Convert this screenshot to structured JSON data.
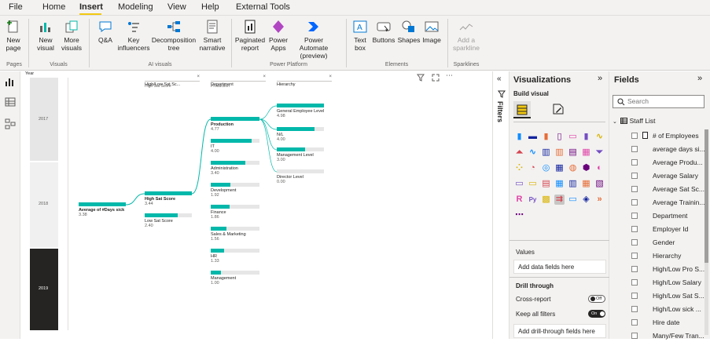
{
  "menu": [
    "File",
    "Home",
    "Insert",
    "Modeling",
    "View",
    "Help",
    "External Tools"
  ],
  "menu_active": "Insert",
  "ribbon": {
    "new_page": "New\npage",
    "new_visual": "New\nvisual",
    "more_visuals": "More\nvisuals",
    "qa": "Q&A",
    "key_influencers": "Key\ninfluencers",
    "decomposition_tree": "Decomposition\ntree",
    "smart_narrative": "Smart\nnarrative",
    "paginated_report": "Paginated\nreport",
    "power_apps": "Power\nApps",
    "power_automate": "Power Automate\n(preview)",
    "text_box": "Text\nbox",
    "buttons": "Buttons",
    "shapes": "Shapes",
    "image": "Image",
    "add_sparkline": "Add a\nsparkline",
    "groups": {
      "pages": "Pages",
      "visuals": "Visuals",
      "ai": "AI visuals",
      "platform": "Power Platform",
      "elements": "Elements",
      "sparklines": "Sparklines"
    }
  },
  "canvas": {
    "year_label": "Year",
    "years": [
      "2017",
      "2018",
      "2019"
    ],
    "headers": [
      {
        "title": "High/Low Sat Sc...",
        "sub": "High Sat Score"
      },
      {
        "title": "Department",
        "sub": "Production"
      },
      {
        "title": "Hierarchy",
        "sub": ""
      }
    ],
    "root": {
      "label": "Average of #Days sick",
      "value": "3.38"
    },
    "level1": [
      {
        "label": "High Sat Score",
        "value": "3.44",
        "bold": true,
        "fill": 1.0
      },
      {
        "label": "Low Sat Score",
        "value": "2.40",
        "bold": false,
        "fill": 0.7
      }
    ],
    "level2": [
      {
        "label": "Production",
        "value": "4.77",
        "bold": true,
        "fill": 1.0
      },
      {
        "label": "IT",
        "value": "4.00",
        "bold": false,
        "fill": 0.84
      },
      {
        "label": "Administration",
        "value": "3.40",
        "bold": false,
        "fill": 0.71
      },
      {
        "label": "Development",
        "value": "1.92",
        "bold": false,
        "fill": 0.4
      },
      {
        "label": "Finance",
        "value": "1.86",
        "bold": false,
        "fill": 0.39
      },
      {
        "label": "Sales & Marketing",
        "value": "1.56",
        "bold": false,
        "fill": 0.33
      },
      {
        "label": "HR",
        "value": "1.33",
        "bold": false,
        "fill": 0.28
      },
      {
        "label": "Management",
        "value": "1.00",
        "bold": false,
        "fill": 0.21
      }
    ],
    "level3": [
      {
        "label": "General Employee Level",
        "value": "4.98",
        "fill": 1.0
      },
      {
        "label": "N/L",
        "value": "4.00",
        "fill": 0.8
      },
      {
        "label": "Management Level",
        "value": "3.00",
        "fill": 0.6
      },
      {
        "label": "Director Level",
        "value": "0.00",
        "fill": 0.0
      }
    ]
  },
  "filters_label": "Filters",
  "viz": {
    "title": "Visualizations",
    "build_visual": "Build visual",
    "values_label": "Values",
    "add_data_fields": "Add data fields here",
    "drill_through": "Drill through",
    "cross_report": "Cross-report",
    "cross_report_state": "Off",
    "keep_all_filters": "Keep all filters",
    "keep_all_filters_state": "On",
    "add_drill_fields": "Add drill-through fields here"
  },
  "fields": {
    "title": "Fields",
    "search_placeholder": "Search",
    "table": "Staff List",
    "items": [
      "# of Employees",
      "average days si...",
      "Average Produ...",
      "Average Salary",
      "Average Sat Sc...",
      "Average Trainin...",
      "Department",
      "Employer Id",
      "Gender",
      "Hierarchy",
      "High/Low Pro S...",
      "High/Low Salary",
      "High/Low Sat S...",
      "High/Low sick ...",
      "Hire date",
      "Many/Few Tran..."
    ]
  },
  "colors": {
    "accent": "#01b8aa",
    "yellow": "#f2c811",
    "dark": "#252423"
  }
}
